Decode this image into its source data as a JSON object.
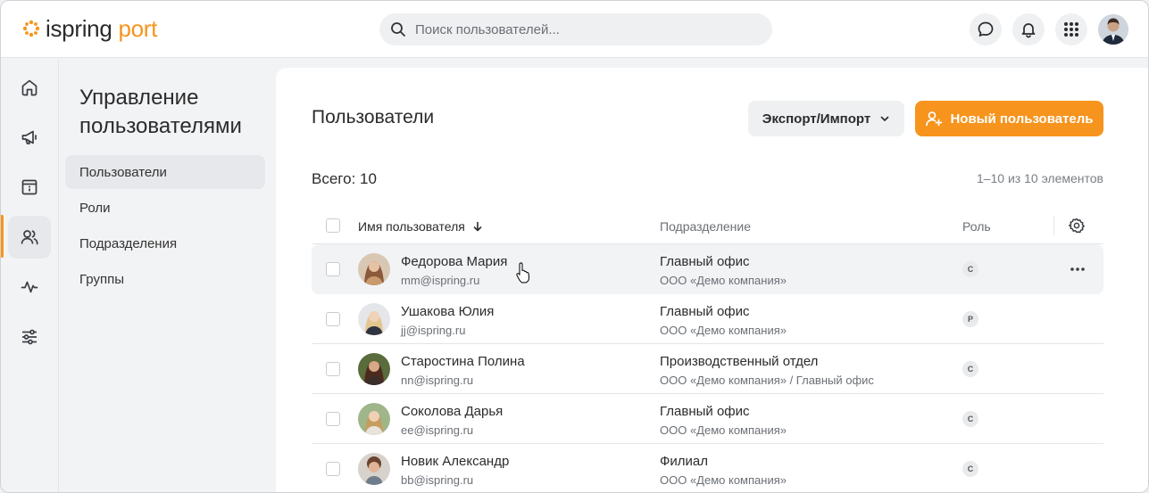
{
  "brand": {
    "name_part1": "ispring",
    "name_part2": "port",
    "accent": "#f7941d"
  },
  "search": {
    "placeholder": "Поиск пользователей..."
  },
  "topbar_icons": [
    "chat-icon",
    "bell-icon",
    "apps-grid-icon",
    "user-avatar"
  ],
  "rail": [
    "home-icon",
    "megaphone-icon",
    "info-card-icon",
    "users-icon",
    "activity-icon",
    "sliders-icon"
  ],
  "rail_active": "users-icon",
  "subnav": {
    "title": "Управление пользователями",
    "items": [
      {
        "label": "Пользователи",
        "active": true
      },
      {
        "label": "Роли",
        "active": false
      },
      {
        "label": "Подразделения",
        "active": false
      },
      {
        "label": "Группы",
        "active": false
      }
    ]
  },
  "main": {
    "title": "Пользователи",
    "export_label": "Экспорт/Импорт",
    "new_user_label": "Новый пользователь",
    "total": "Всего: 10",
    "range": "1–10 из 10 элементов",
    "columns": {
      "name": "Имя пользователя",
      "department": "Подразделение",
      "role": "Роль"
    },
    "rows": [
      {
        "name": "Федорова Мария",
        "email": "mm@ispring.ru",
        "department": "Главный офис",
        "org": "ООО «Демо компания»",
        "role": "С"
      },
      {
        "name": "Ушакова Юлия",
        "email": "jj@ispring.ru",
        "department": "Главный офис",
        "org": "ООО «Демо компания»",
        "role": "Р"
      },
      {
        "name": "Старостина Полина",
        "email": "nn@ispring.ru",
        "department": "Производственный отдел",
        "org": "ООО «Демо компания» / Главный офис",
        "role": "С"
      },
      {
        "name": "Соколова Дарья",
        "email": "ee@ispring.ru",
        "department": "Главный офис",
        "org": "ООО «Демо компания»",
        "role": "С"
      },
      {
        "name": "Новик Александр",
        "email": "bb@ispring.ru",
        "department": "Филиал",
        "org": "ООО «Демо компания»",
        "role": "С"
      }
    ]
  }
}
